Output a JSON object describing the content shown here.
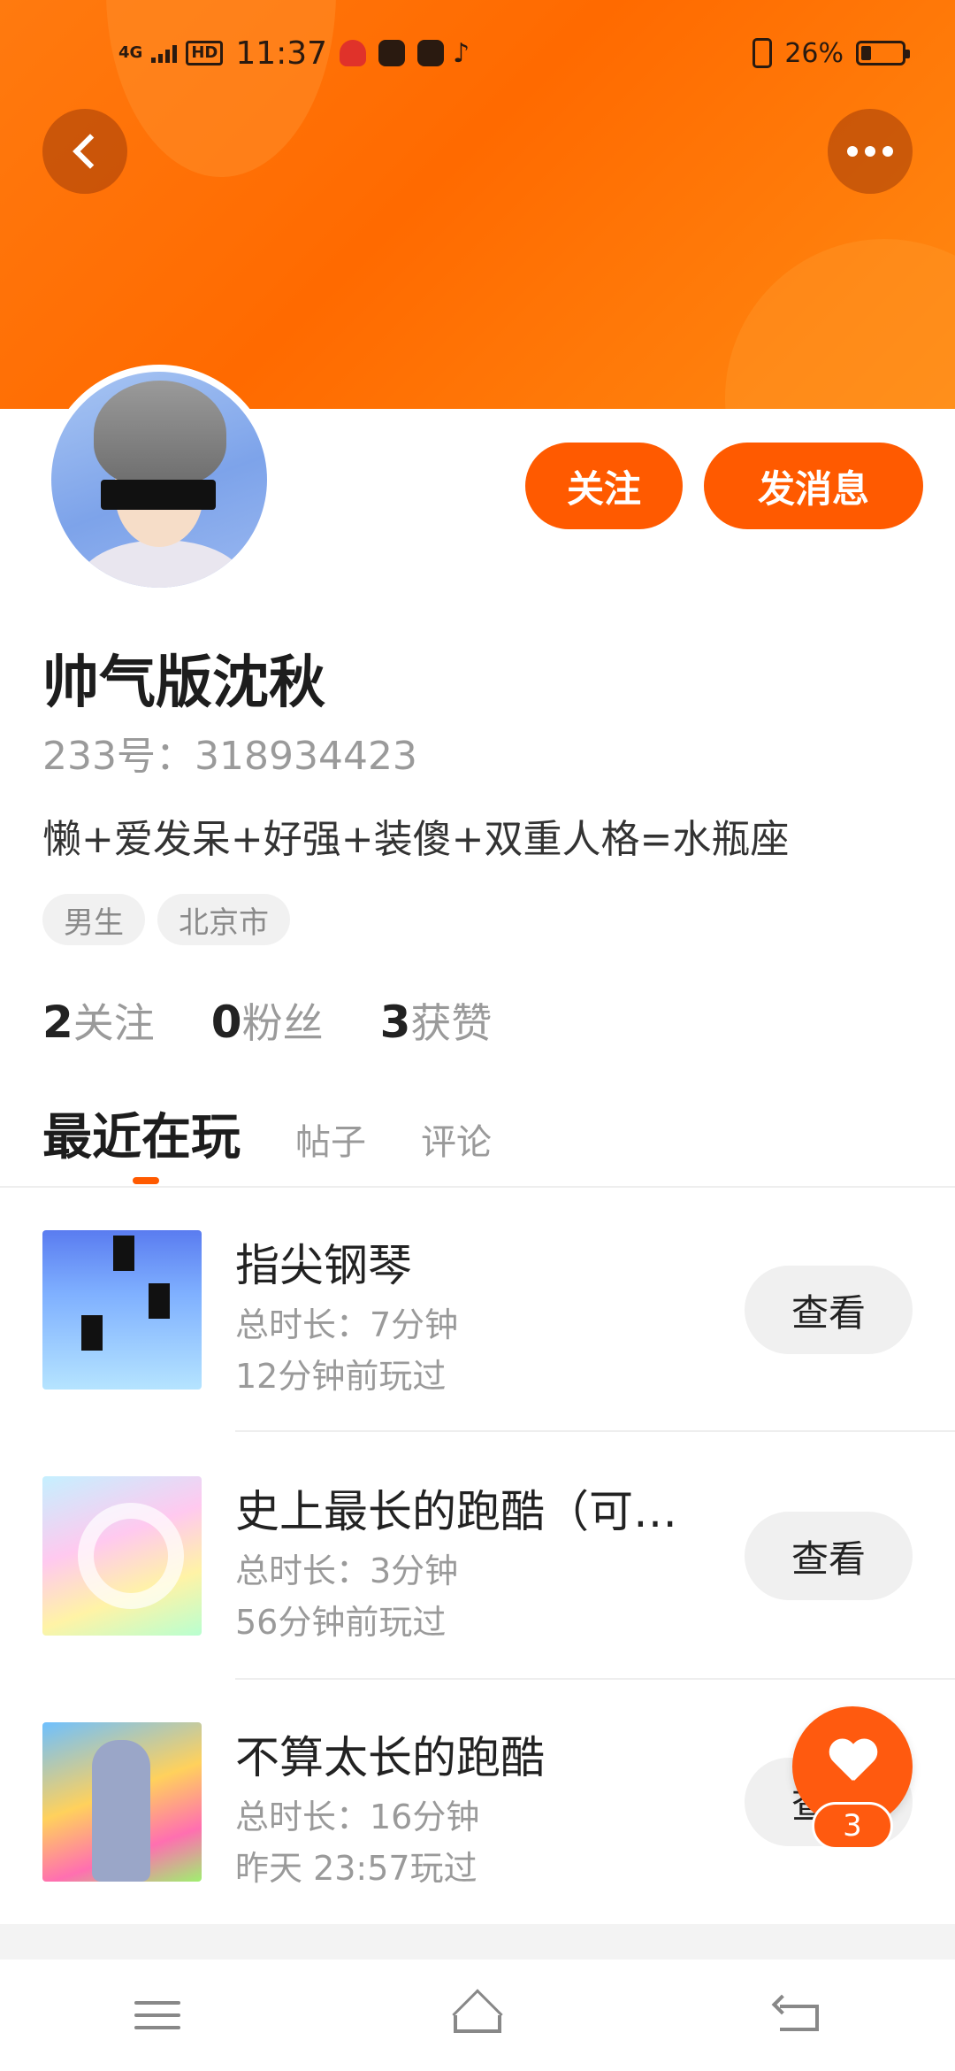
{
  "status_bar": {
    "network": "4G",
    "hd": "HD",
    "time": "11:37",
    "battery_percent": "26%",
    "battery_level": 0.26
  },
  "header": {
    "back_icon": "chevron-left-icon",
    "more_icon": "more-dots-icon"
  },
  "profile": {
    "follow_label": "关注",
    "message_label": "发消息",
    "name": "帅气版沈秋",
    "uid": "233号：318934423",
    "bio": "懒+爱发呆+好强+装傻+双重人格=水瓶座",
    "tags": [
      "男生",
      "北京市"
    ],
    "stats": [
      {
        "num": "2",
        "label": "关注"
      },
      {
        "num": "0",
        "label": "粉丝"
      },
      {
        "num": "3",
        "label": "获赞"
      }
    ]
  },
  "tabs": [
    "最近在玩",
    "帖子",
    "评论"
  ],
  "games": [
    {
      "title": "指尖钢琴",
      "duration": "总时长：7分钟",
      "last_played": "12分钟前玩过",
      "action": "查看"
    },
    {
      "title": "史上最长的跑酷（可…",
      "duration": "总时长：3分钟",
      "last_played": "56分钟前玩过",
      "action": "查看"
    },
    {
      "title": "不算太长的跑酷",
      "duration": "总时长：16分钟",
      "last_played": "昨天 23:57玩过",
      "action": "查看"
    }
  ],
  "fab": {
    "icon": "heart-icon",
    "count": "3"
  },
  "colors": {
    "accent": "#ff5a00",
    "banner": "#ff7a0f"
  }
}
